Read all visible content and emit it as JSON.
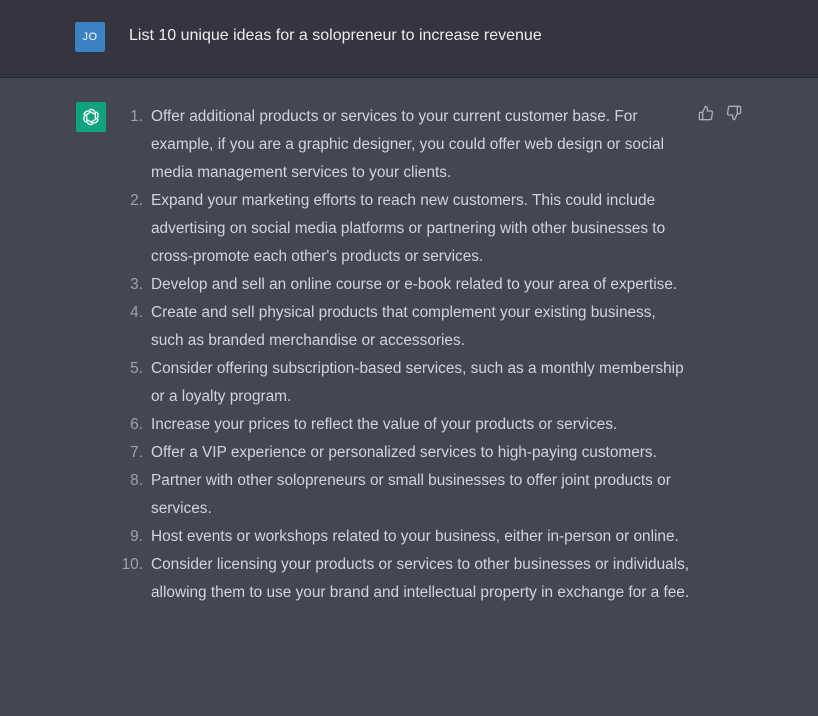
{
  "user_message": {
    "avatar_initials": "JO",
    "text": "List 10 unique ideas for a solopreneur to increase revenue"
  },
  "assistant_message": {
    "items": [
      {
        "number": "1.",
        "text": "Offer additional products or services to your current customer base. For example, if you are a graphic designer, you could offer web design or social media management services to your clients."
      },
      {
        "number": "2.",
        "text": "Expand your marketing efforts to reach new customers. This could include advertising on social media platforms or partnering with other businesses to cross-promote each other's products or services."
      },
      {
        "number": "3.",
        "text": "Develop and sell an online course or e-book related to your area of expertise."
      },
      {
        "number": "4.",
        "text": "Create and sell physical products that complement your existing business, such as branded merchandise or accessories."
      },
      {
        "number": "5.",
        "text": "Consider offering subscription-based services, such as a monthly membership or a loyalty program."
      },
      {
        "number": "6.",
        "text": "Increase your prices to reflect the value of your products or services."
      },
      {
        "number": "7.",
        "text": "Offer a VIP experience or personalized services to high-paying customers."
      },
      {
        "number": "8.",
        "text": "Partner with other solopreneurs or small businesses to offer joint products or services."
      },
      {
        "number": "9.",
        "text": "Host events or workshops related to your business, either in-person or online."
      },
      {
        "number": "10.",
        "text": "Consider licensing your products or services to other businesses or individuals, allowing them to use your brand and intellectual property in exchange for a fee."
      }
    ]
  },
  "icons": {
    "user_avatar": "user-avatar",
    "assistant_avatar": "openai-logo-icon",
    "thumbs_up": "thumbs-up-icon",
    "thumbs_down": "thumbs-down-icon"
  },
  "colors": {
    "user_bg": "#343541",
    "assistant_bg": "#444654",
    "user_avatar_bg": "#3b82c4",
    "assistant_avatar_bg": "#10a37f"
  }
}
